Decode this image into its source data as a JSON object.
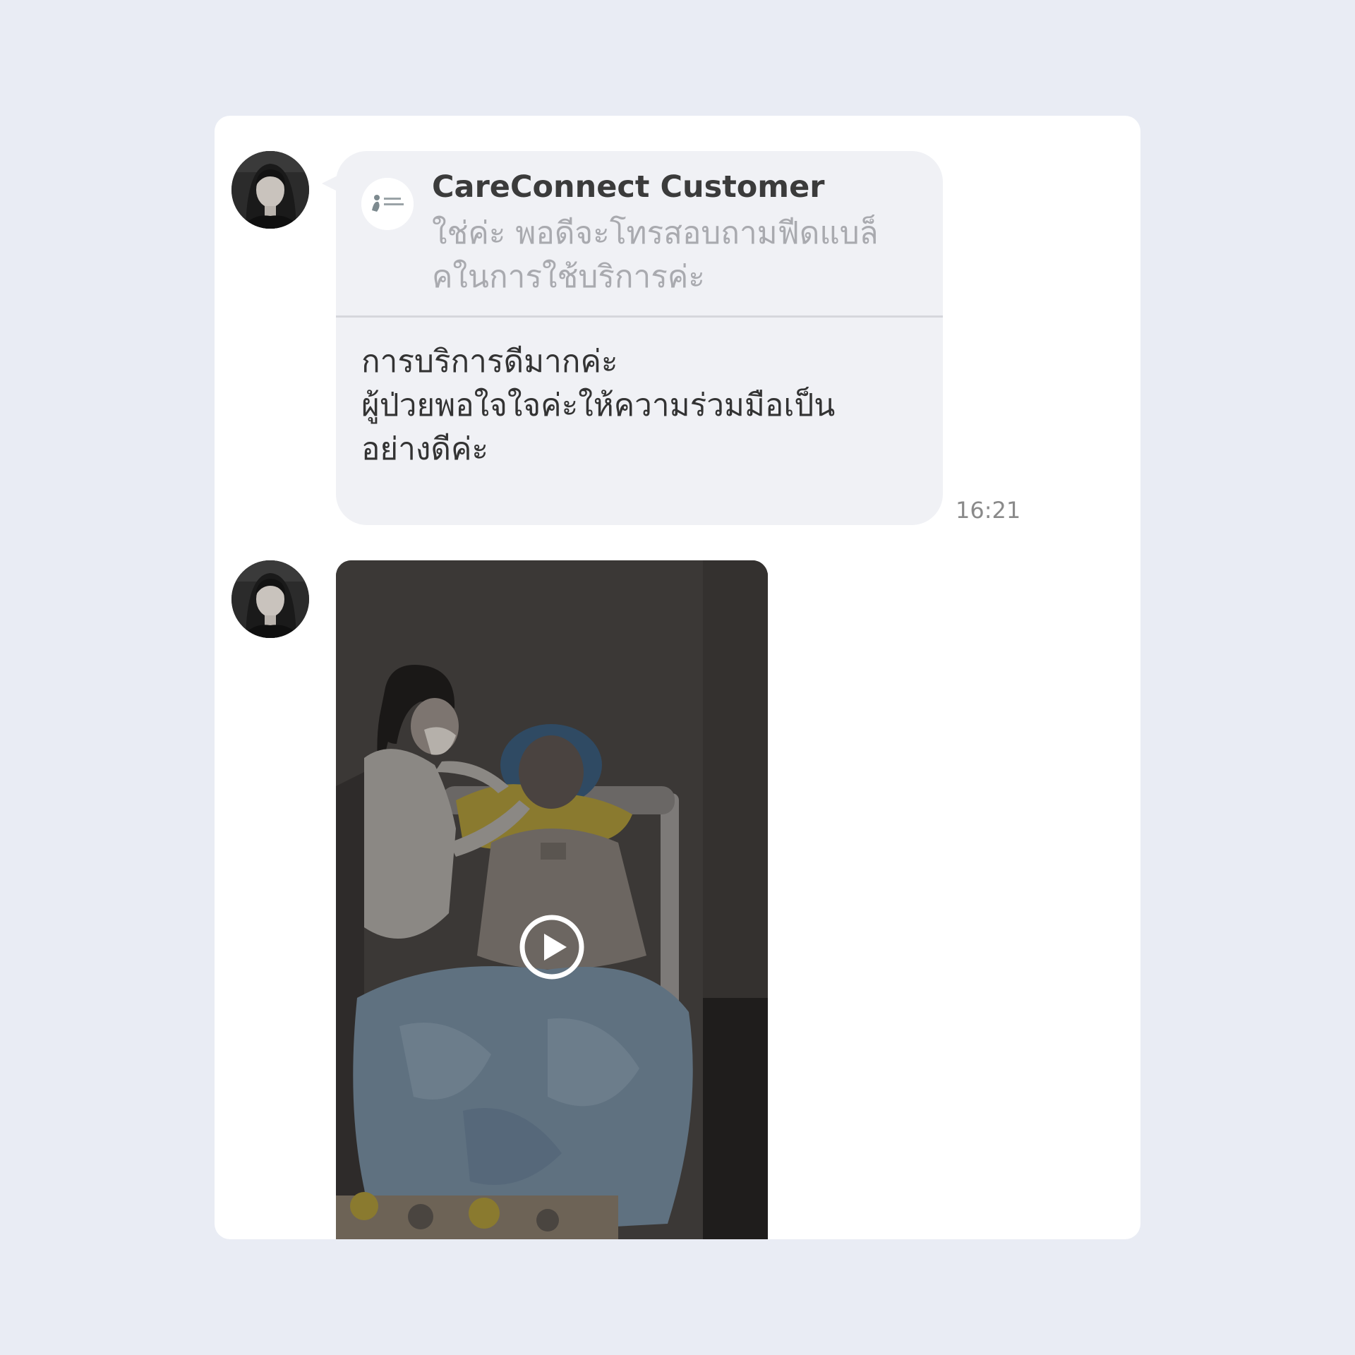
{
  "conversation": {
    "messages": [
      {
        "sender_avatar_icon": "profile-photo-avatar",
        "reply_to": {
          "logo_icon": "careconnect-logo-icon",
          "name": "CareConnect Customer",
          "text_lines": [
            "ใช่ค่ะ พอดีจะโทรสอบถามฟีดแบล็",
            "คในการใช้บริการค่ะ"
          ]
        },
        "text_lines": [
          "การบริการดีมากค่ะ",
          "ผู้ป่วยพอใจใจค่ะให้ความร่วมมือเป็น",
          "อย่างดีค่ะ"
        ],
        "time": "16:21"
      },
      {
        "sender_avatar_icon": "profile-photo-avatar",
        "type": "video",
        "play_icon": "play-circle-icon"
      }
    ]
  },
  "colors": {
    "page_bg": "#e9ecf4",
    "card_bg": "#ffffff",
    "bubble_bg": "#f0f1f5",
    "reply_text": "#a9aaaf",
    "message_text": "#333333",
    "time_text": "#8a8a8a"
  }
}
